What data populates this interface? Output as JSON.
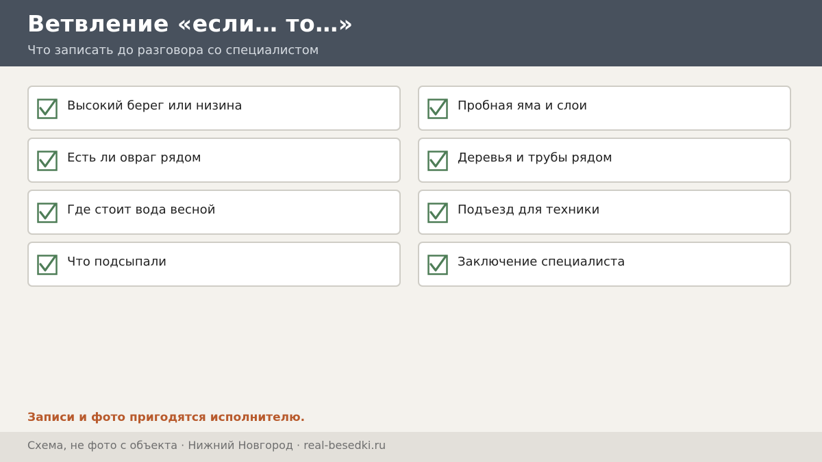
{
  "header": {
    "title": "Ветвление «если… то…»",
    "subtitle": "Что записать до разговора со специалистом"
  },
  "checklist": {
    "left": [
      {
        "label": "Высокий берег или низина",
        "checked": true
      },
      {
        "label": "Есть ли овраг рядом",
        "checked": true
      },
      {
        "label": "Где стоит вода весной",
        "checked": true
      },
      {
        "label": "Что подсыпали",
        "checked": true
      }
    ],
    "right": [
      {
        "label": "Пробная яма и слои",
        "checked": true
      },
      {
        "label": "Деревья и трубы рядом",
        "checked": true
      },
      {
        "label": "Подъезд для техники",
        "checked": true
      },
      {
        "label": "Заключение специалиста",
        "checked": true
      }
    ]
  },
  "note": "Записи и фото пригодятся исполнителю.",
  "footer": {
    "text": "Схема, не фото с объекта  ·  Нижний Новгород  ·  real-besedki.ru"
  },
  "colors": {
    "header_bg": "#48515d",
    "page_bg": "#f4f2ed",
    "check_green": "#4e7d57",
    "accent": "#b85a2c",
    "footer_bg": "#e3e0da"
  }
}
